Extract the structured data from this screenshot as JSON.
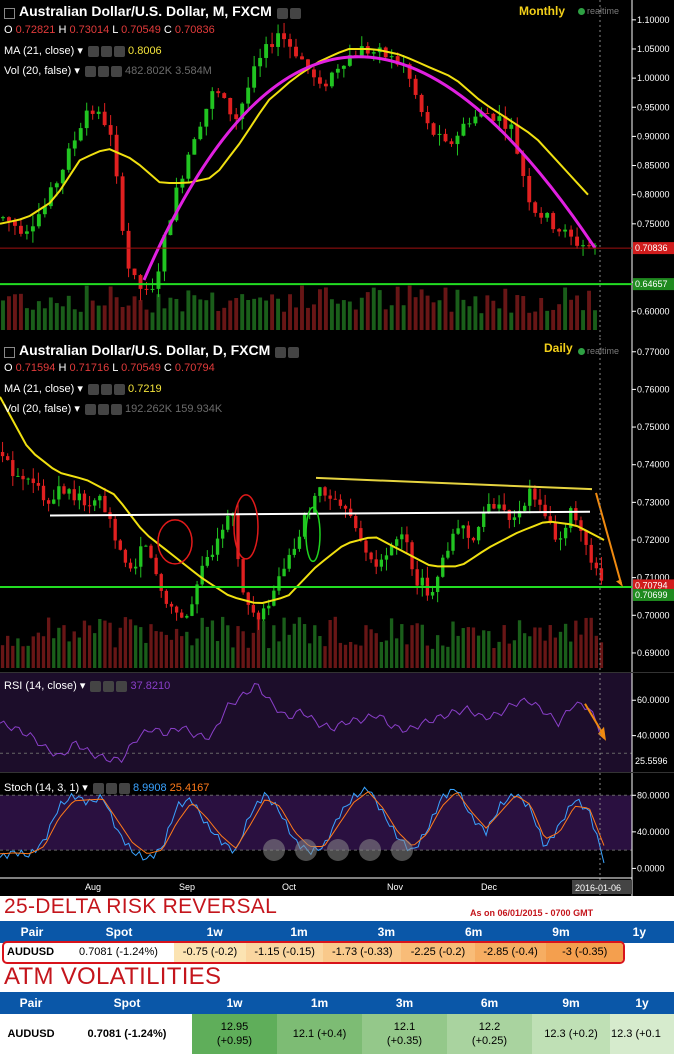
{
  "colors": {
    "bull": "#21c421",
    "bear": "#e02020",
    "ma": "#f0e010",
    "arc": "#e020e0",
    "hline": "#22dd22",
    "trend": "#e6d440",
    "white_line": "#ffffff",
    "rsi": "#8a3fc9",
    "stoch_k": "#3aa3ff",
    "stoch_d": "#ff7a1a",
    "header_bg": "#0a57a8",
    "title_red": "#c4151c"
  },
  "monthly": {
    "title": "Australian Dollar/U.S. Dollar, M, FXCM",
    "ohlc": {
      "o_label": "O",
      "o": "0.72821",
      "h_label": "H",
      "h": "0.73014",
      "l_label": "L",
      "l": "0.70549",
      "c_label": "C",
      "c": "0.70836"
    },
    "ma_label": "MA (21, close)",
    "ma_value": "0.8006",
    "vol_label": "Vol (20, false)",
    "vol_value1": "482.802K",
    "vol_value2": "3.584M",
    "timeframe": "Monthly",
    "realtime": "realtime",
    "price_tag": "0.70836",
    "level_tag": "0.64657",
    "ticks": [
      "1.10000",
      "1.05000",
      "1.00000",
      "0.95000",
      "0.90000",
      "0.85000",
      "0.80000",
      "0.75000",
      "0.65000",
      "0.60000"
    ]
  },
  "daily": {
    "title": "Australian Dollar/U.S. Dollar, D, FXCM",
    "ohlc": {
      "o_label": "O",
      "o": "0.71594",
      "h_label": "H",
      "h": "0.71716",
      "l_label": "L",
      "l": "0.70549",
      "c_label": "C",
      "c": "0.70794"
    },
    "ma_label": "MA (21, close)",
    "ma_value": "0.7219",
    "vol_label": "Vol (20, false)",
    "vol_value1": "192.262K",
    "vol_value2": "159.934K",
    "timeframe": "Daily",
    "realtime": "realtime",
    "price_tag": "0.70794",
    "level_tag": "0.70699",
    "ticks": [
      "0.77000",
      "0.76000",
      "0.75000",
      "0.74000",
      "0.73000",
      "0.72000",
      "0.71000",
      "0.70000",
      "0.69000"
    ]
  },
  "rsi": {
    "label": "RSI (14, close)",
    "value": "37.8210",
    "ticks": [
      "60.0000",
      "40.0000"
    ],
    "tag": "25.5596"
  },
  "stoch": {
    "label": "Stoch (14, 3, 1)",
    "k": "8.9908",
    "d": "25.4167",
    "ticks": [
      "80.0000",
      "40.0000",
      "0.0000"
    ]
  },
  "xaxis": {
    "labels": [
      "Aug",
      "Sep",
      "Oct",
      "Nov",
      "Dec"
    ],
    "date_tag": "2016-01-06"
  },
  "rr": {
    "title": "25-DELTA RISK REVERSAL",
    "asof": "As on 06/01/2015 - 0700 GMT",
    "headers": [
      "Pair",
      "Spot",
      "1w",
      "1m",
      "3m",
      "6m",
      "9m",
      "1y"
    ],
    "row": {
      "pair": "AUDUSD",
      "spot": "0.7081 (-1.24%)",
      "values": [
        "-0.75 (-0.2)",
        "-1.15 (-0.15)",
        "-1.73 (-0.33)",
        "-2.25 (-0.2)",
        "-2.85 (-0.4)",
        "-3 (-0.35)"
      ]
    }
  },
  "atm": {
    "title": "ATM VOLATILITIES",
    "headers": [
      "Pair",
      "Spot",
      "1w",
      "1m",
      "3m",
      "6m",
      "9m",
      "1y"
    ],
    "row": {
      "pair": "AUDUSD",
      "spot": "0.7081 (-1.24%)",
      "values": [
        [
          "12.95",
          "(+0.95)"
        ],
        [
          "12.1 (+0.4)"
        ],
        [
          "12.1",
          "(+0.35)"
        ],
        [
          "12.2",
          "(+0.25)"
        ],
        [
          "12.3 (+0.2)"
        ],
        [
          "12.3 (+0.1"
        ]
      ]
    }
  },
  "chart_data": [
    {
      "type": "candlestick",
      "name": "monthly",
      "title": "Australian Dollar/U.S. Dollar, M, FXCM",
      "ylim": [
        0.585,
        1.11
      ],
      "close_path": [
        0.76,
        0.74,
        0.78,
        0.86,
        0.95,
        0.92,
        0.66,
        0.62,
        0.78,
        0.9,
        0.98,
        0.93,
        1.02,
        1.08,
        1.04,
        0.98,
        1.03,
        1.05,
        1.04,
        1.02,
        0.92,
        0.88,
        0.93,
        0.94,
        0.92,
        0.78,
        0.75,
        0.72,
        0.7084
      ],
      "ma_path": [
        0.75,
        0.76,
        0.79,
        0.86,
        0.88,
        0.86,
        0.82,
        0.82,
        0.83,
        0.89,
        0.96,
        1.0,
        1.03,
        1.05,
        1.05,
        1.04,
        1.02,
        1.0,
        0.96,
        0.93,
        0.9,
        0.85,
        0.8
      ],
      "horizontal_level": 0.64657
    },
    {
      "type": "candlestick",
      "name": "daily",
      "title": "Australian Dollar/U.S. Dollar, D, FXCM",
      "ylim": [
        0.686,
        0.771
      ],
      "close_path": [
        0.742,
        0.736,
        0.738,
        0.729,
        0.735,
        0.732,
        0.729,
        0.731,
        0.718,
        0.712,
        0.72,
        0.708,
        0.701,
        0.7,
        0.712,
        0.72,
        0.73,
        0.703,
        0.698,
        0.706,
        0.714,
        0.723,
        0.734,
        0.73,
        0.728,
        0.72,
        0.712,
        0.716,
        0.722,
        0.71,
        0.706,
        0.715,
        0.724,
        0.721,
        0.728,
        0.73,
        0.724,
        0.733,
        0.726,
        0.72,
        0.728,
        0.716,
        0.7079
      ],
      "ma_path": [
        0.758,
        0.744,
        0.738,
        0.736,
        0.732,
        0.722,
        0.716,
        0.71,
        0.705,
        0.703,
        0.705,
        0.713,
        0.719,
        0.721,
        0.717,
        0.713,
        0.713,
        0.718,
        0.722,
        0.725,
        0.724,
        0.72
      ],
      "trendline": [
        [
          0.7365,
          0.7335
        ]
      ],
      "support_line": 0.727,
      "horizontal_level": 0.7075
    },
    {
      "type": "line",
      "name": "RSI (14, close)",
      "ylim": [
        20,
        72
      ],
      "values": [
        47,
        44,
        40,
        33,
        28,
        36,
        30,
        27,
        26,
        38,
        44,
        41,
        45,
        40,
        39,
        56,
        62,
        69,
        58,
        50,
        54,
        47,
        44,
        48,
        49,
        52,
        45,
        43,
        47,
        50,
        53,
        55,
        50,
        52,
        58,
        60,
        54,
        47,
        58,
        56,
        38
      ]
    },
    {
      "type": "line",
      "name": "Stoch (14, 3, 1)",
      "ylim": [
        -5,
        100
      ],
      "series": [
        {
          "name": "%K",
          "values": [
            12,
            18,
            14,
            30,
            68,
            80,
            72,
            78,
            40,
            18,
            10,
            22,
            68,
            76,
            48,
            30,
            18,
            60,
            82,
            62,
            30,
            18,
            24,
            58,
            78,
            88,
            60,
            34,
            18,
            42,
            78,
            88,
            56,
            40,
            70,
            82,
            66,
            22,
            48,
            76,
            62,
            9
          ]
        },
        {
          "name": "%D",
          "values": [
            16,
            17,
            16,
            24,
            55,
            74,
            75,
            76,
            52,
            28,
            16,
            20,
            50,
            72,
            56,
            36,
            22,
            48,
            76,
            68,
            40,
            24,
            24,
            48,
            72,
            84,
            66,
            40,
            24,
            38,
            68,
            84,
            62,
            44,
            62,
            80,
            70,
            32,
            40,
            68,
            66,
            25
          ]
        }
      ]
    }
  ]
}
